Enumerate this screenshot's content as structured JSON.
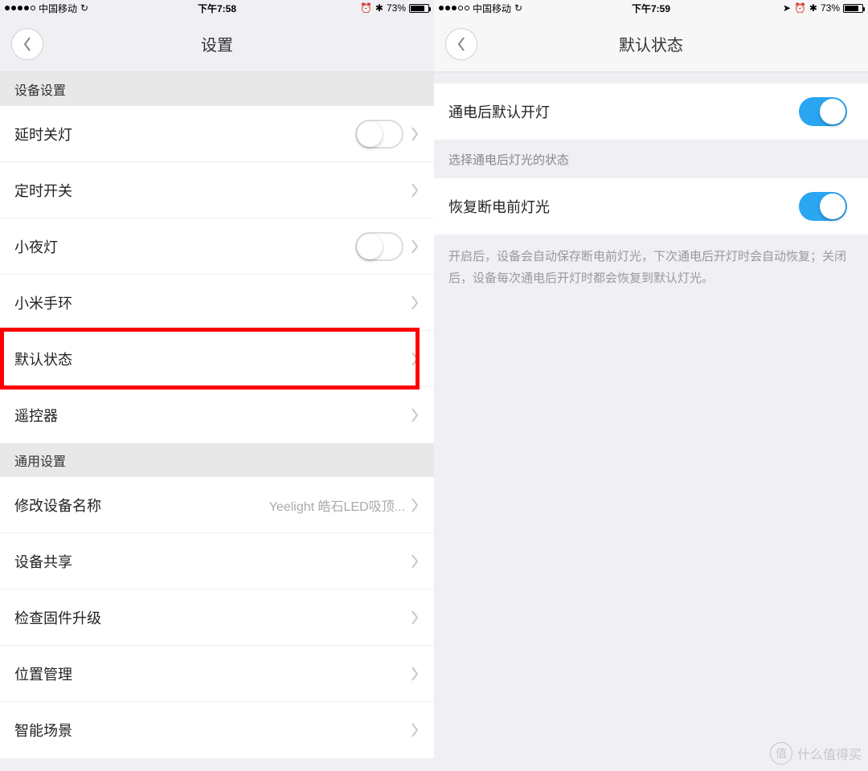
{
  "left": {
    "status": {
      "carrier": "中国移动",
      "time": "下午7:58",
      "battery": "73%",
      "signal_filled": 4
    },
    "title": "设置",
    "sections": [
      {
        "header": "设备设置",
        "rows": [
          {
            "label": "延时关灯",
            "toggle": "off",
            "chevron": true
          },
          {
            "label": "定时开关",
            "chevron": true
          },
          {
            "label": "小夜灯",
            "toggle": "off",
            "chevron": true
          },
          {
            "label": "小米手环",
            "chevron": true
          },
          {
            "label": "默认状态",
            "chevron": true,
            "highlight": true
          },
          {
            "label": "遥控器",
            "chevron": true
          }
        ]
      },
      {
        "header": "通用设置",
        "rows": [
          {
            "label": "修改设备名称",
            "value": "Yeelight 皓石LED吸顶...",
            "chevron": true
          },
          {
            "label": "设备共享",
            "chevron": true
          },
          {
            "label": "检查固件升级",
            "chevron": true
          },
          {
            "label": "位置管理",
            "chevron": true
          },
          {
            "label": "智能场景",
            "chevron": true
          }
        ]
      }
    ]
  },
  "right": {
    "status": {
      "carrier": "中国移动",
      "time": "下午7:59",
      "battery": "73%",
      "signal_filled": 3,
      "location": true
    },
    "title": "默认状态",
    "group1": {
      "rows": [
        {
          "label": "通电后默认开灯",
          "toggle": "on"
        }
      ]
    },
    "group2_header": "选择通电后灯光的状态",
    "group2": {
      "rows": [
        {
          "label": "恢复断电前灯光",
          "toggle": "on"
        }
      ]
    },
    "note": "开启后，设备会自动保存断电前灯光，下次通电后开灯时会自动恢复；关闭后，设备每次通电后开灯时都会恢复到默认灯光。"
  },
  "watermark": {
    "badge": "值",
    "text": "什么值得买"
  }
}
